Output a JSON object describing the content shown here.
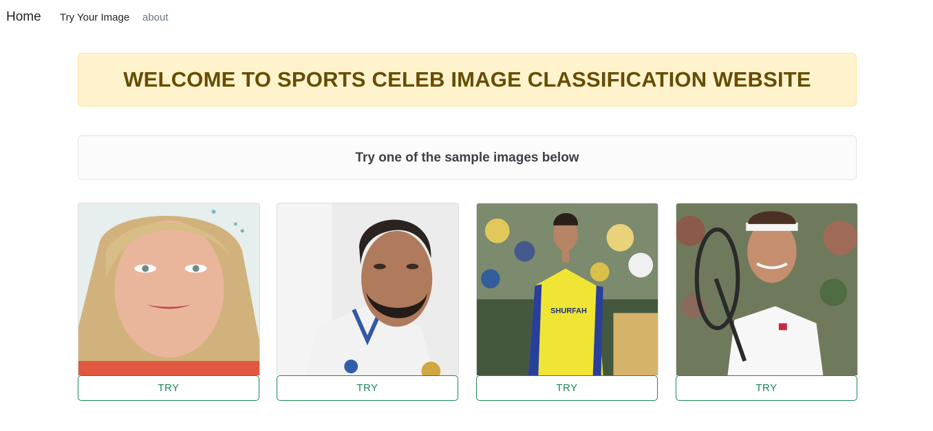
{
  "nav": {
    "brand": "Home",
    "links": [
      {
        "label": "Try Your Image"
      },
      {
        "label": "about"
      }
    ]
  },
  "banner": {
    "title": "WELCOME TO SPORTS CELEB IMAGE CLASSIFICATION WEBSITE"
  },
  "samples": {
    "heading": "Try one of the sample images below",
    "cards": [
      {
        "button_label": "TRY"
      },
      {
        "button_label": "TRY"
      },
      {
        "button_label": "TRY"
      },
      {
        "button_label": "TRY",
        "shirt_text": "SHURFAH"
      }
    ],
    "jersey_text": "SHURFAH"
  },
  "colors": {
    "banner_bg": "#fff3cd",
    "banner_text": "#664d03",
    "button_accent": "#198754",
    "nav_muted": "#6c757d"
  }
}
